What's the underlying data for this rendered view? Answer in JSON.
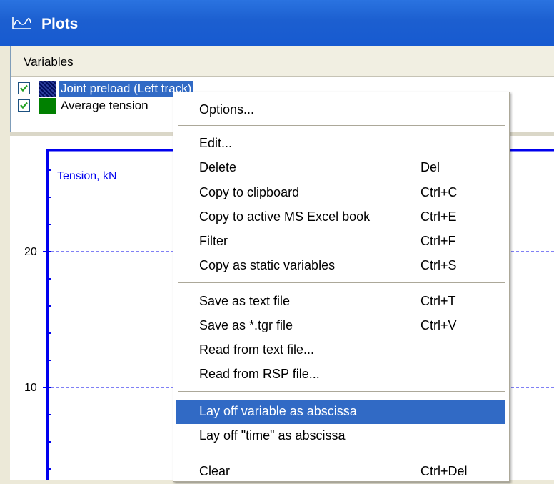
{
  "window": {
    "title": "Plots",
    "accent": "#1c5fd0",
    "icon": "plot-icon"
  },
  "variables_panel": {
    "header": "Variables",
    "items": [
      {
        "label": "Joint preload (Left track)",
        "checked": true,
        "color": "#001a66",
        "selected": true
      },
      {
        "label": "Average tension",
        "checked": true,
        "color": "#008000",
        "selected": false
      }
    ]
  },
  "plot": {
    "ylabel": "Tension, kN",
    "yticks": [
      "20",
      "10"
    ],
    "axis_color": "#0000ee"
  },
  "context_menu": {
    "groups": [
      [
        {
          "label": "Options...",
          "shortcut": ""
        }
      ],
      [
        {
          "label": "Edit...",
          "shortcut": ""
        },
        {
          "label": "Delete",
          "shortcut": "Del"
        },
        {
          "label": "Copy to clipboard",
          "shortcut": "Ctrl+C"
        },
        {
          "label": "Copy to active MS Excel book",
          "shortcut": "Ctrl+E"
        },
        {
          "label": "Filter",
          "shortcut": "Ctrl+F"
        },
        {
          "label": "Copy as static variables",
          "shortcut": "Ctrl+S"
        }
      ],
      [
        {
          "label": "Save as text file",
          "shortcut": "Ctrl+T"
        },
        {
          "label": "Save as *.tgr file",
          "shortcut": "Ctrl+V"
        },
        {
          "label": "Read from text file...",
          "shortcut": ""
        },
        {
          "label": "Read from RSP file...",
          "shortcut": ""
        }
      ],
      [
        {
          "label": "Lay off variable as abscissa",
          "shortcut": "",
          "highlighted": true
        },
        {
          "label": "Lay off \"time\" as abscissa",
          "shortcut": ""
        }
      ],
      [
        {
          "label": "Clear",
          "shortcut": "Ctrl+Del"
        }
      ]
    ]
  }
}
